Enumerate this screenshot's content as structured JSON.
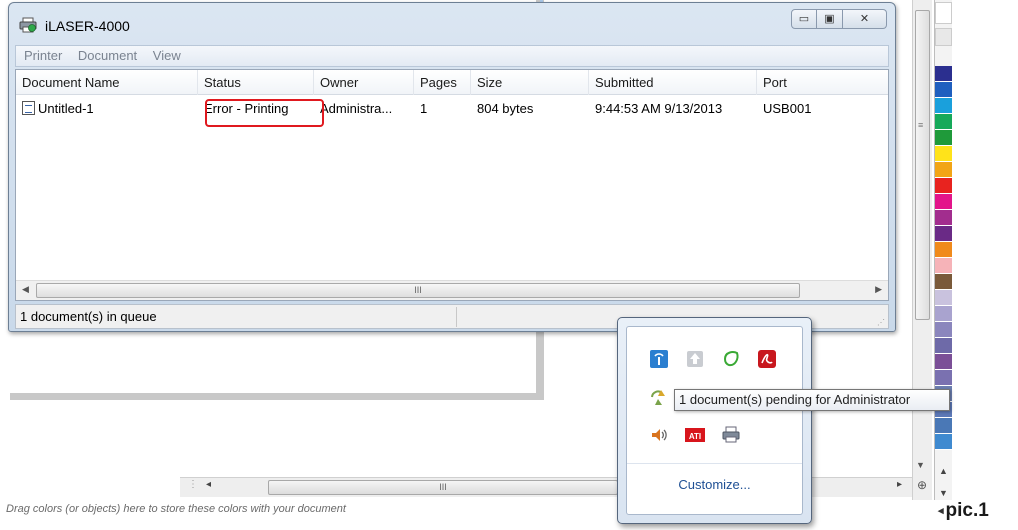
{
  "window": {
    "title": "iLASER-4000",
    "buttons": {
      "minimize": "▭",
      "maximize": "▣",
      "close": "✕"
    }
  },
  "menu": [
    "Printer",
    "Document",
    "View"
  ],
  "columns": [
    "Document Name",
    "Status",
    "Owner",
    "Pages",
    "Size",
    "Submitted",
    "Port"
  ],
  "rows": [
    {
      "name": "Untitled-1",
      "status": "Error - Printing",
      "owner": "Administra...",
      "pages": "1",
      "size": "804 bytes",
      "submitted": "9:44:53 AM 9/13/2013",
      "port": "USB001"
    }
  ],
  "status_bar": {
    "text": "1 document(s) in queue"
  },
  "scroll_grip": "III",
  "tray": {
    "icons": [
      "network-icon",
      "upload-icon",
      "green-leaf-icon",
      "acrobat-icon",
      "sync-icon",
      "speaker-icon",
      "ati-icon",
      "printer-icon"
    ],
    "ati_label": "ATI",
    "customize_label": "Customize...",
    "tooltip": "1 document(s) pending for Administrator"
  },
  "bottom_hint": "Drag colors (or objects) here to store these colors with your document",
  "pic_label": "pic.1",
  "palette_colors": [
    "#2b2f8f",
    "#1f5fbf",
    "#1aa0dc",
    "#16a95a",
    "#1f9a3a",
    "#ffe31a",
    "#f2a516",
    "#e8231f",
    "#e3148a",
    "#a22d8e",
    "#6a2a86",
    "#f08a1c",
    "#f6b3b8",
    "#7a5a3a",
    "#c9c2de",
    "#a9a3cf",
    "#8b86bd",
    "#6e6aa8",
    "#7b4f97",
    "#7a71b0",
    "#6c7fb0",
    "#5d79b7",
    "#4a78b6",
    "#3f8ad0"
  ],
  "accent": {
    "highlight": "#e0191f",
    "link": "#1e4f94"
  }
}
